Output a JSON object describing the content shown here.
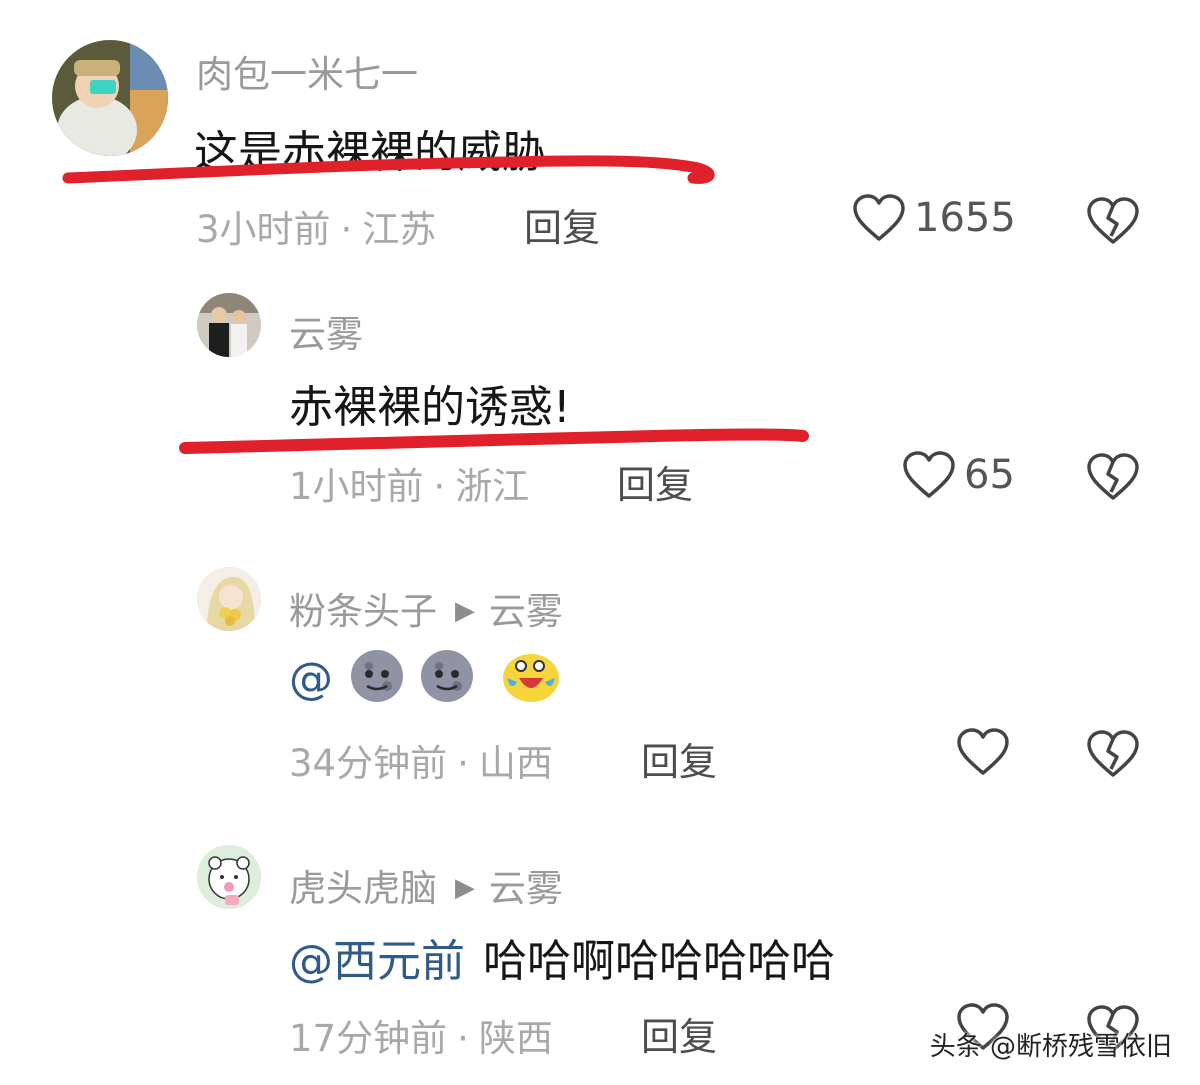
{
  "comments": [
    {
      "username": "肉包一米七一",
      "text": "这是赤裸裸的威胁",
      "time": "3小时前",
      "location": "江苏",
      "reply_label": "回复",
      "likes": "1655"
    },
    {
      "username": "云雾",
      "text": "赤裸裸的诱惑!",
      "time": "1小时前",
      "location": "浙江",
      "reply_label": "回复",
      "likes": "65"
    },
    {
      "username": "粉条头子",
      "reply_to": "云雾",
      "mention": "@",
      "emojis": [
        "moon-face-emoji",
        "moon-face-emoji",
        "crying-laughing-emoji"
      ],
      "time": "34分钟前",
      "location": "山西",
      "reply_label": "回复",
      "likes": ""
    },
    {
      "username": "虎头虎脑",
      "reply_to": "云雾",
      "mention": "@西元前",
      "text": "哈哈啊哈哈哈哈哈",
      "time": "17分钟前",
      "location": "陕西",
      "reply_label": "回复",
      "likes": ""
    }
  ],
  "separator": "·",
  "watermark": "头条 @断桥残雪依旧",
  "colors": {
    "underline": "#e0202a",
    "mention": "#2f5a8a",
    "meta": "#a8a8a8",
    "username": "#9a9a9a"
  }
}
